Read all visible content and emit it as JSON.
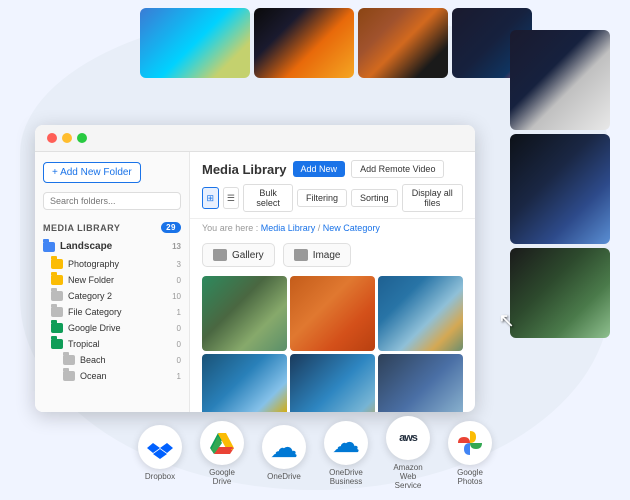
{
  "window": {
    "title": "Media Library",
    "dots": [
      "red",
      "yellow",
      "green"
    ]
  },
  "topPhotos": [
    {
      "class": "tile-aerial-city",
      "name": "aerial-city"
    },
    {
      "class": "tile-fire-spiral",
      "name": "fire-spiral"
    },
    {
      "class": "tile-temple",
      "name": "temple"
    },
    {
      "class": "tile-silhouette",
      "name": "silhouette"
    }
  ],
  "sidebar": {
    "add_button": "+ Add New Folder",
    "search_placeholder": "Search folders...",
    "media_library_label": "MEDIA LIBRARY",
    "media_library_count": "29",
    "landscape_label": "Landscape",
    "landscape_count": "13",
    "folders": [
      {
        "name": "Photography",
        "count": "3",
        "color": "yellow"
      },
      {
        "name": "New Folder",
        "count": "0",
        "color": "yellow"
      },
      {
        "name": "Category 2",
        "count": "10",
        "color": "gray"
      },
      {
        "name": "File Category",
        "count": "1",
        "color": "gray"
      },
      {
        "name": "Google Drive",
        "count": "0",
        "color": "teal"
      },
      {
        "name": "Tropical",
        "count": "0",
        "color": "blue"
      },
      {
        "name": "Beach",
        "count": "0",
        "color": "gray",
        "indent": true
      },
      {
        "name": "Ocean",
        "count": "1",
        "color": "gray",
        "indent": true
      }
    ]
  },
  "toolbar": {
    "add_new": "Add New",
    "add_remote": "Add Remote Video",
    "bulk_select": "Bulk select",
    "filtering": "Filtering",
    "sorting": "Sorting",
    "display_all": "Display all files"
  },
  "breadcrumb": {
    "prefix": "You are here :",
    "library": "Media Library",
    "separator": "/",
    "current": "New Category"
  },
  "folders_cards": [
    {
      "label": "Gallery",
      "icon": "gray"
    },
    {
      "label": "Image",
      "icon": "gray"
    }
  ],
  "images": [
    {
      "class": "img-bali"
    },
    {
      "class": "img-canyon"
    },
    {
      "class": "img-mountains"
    },
    {
      "class": "img-coastal"
    },
    {
      "class": "img-aerial"
    },
    {
      "class": "img-extra"
    }
  ],
  "services": [
    {
      "name": "Dropbox",
      "icon": "📦",
      "color": "#0061ff"
    },
    {
      "name": "Google Drive",
      "icon": "▲",
      "color": "#4285f4"
    },
    {
      "name": "OneDrive",
      "icon": "☁",
      "color": "#0078d4"
    },
    {
      "name": "OneDrive Business",
      "icon": "☁",
      "color": "#0078d4"
    },
    {
      "name": "Amazon Web Service",
      "icon": "aws",
      "type": "text",
      "color": "#ff9900"
    },
    {
      "name": "Google Photos",
      "icon": "✿",
      "color": "#4285f4"
    }
  ]
}
